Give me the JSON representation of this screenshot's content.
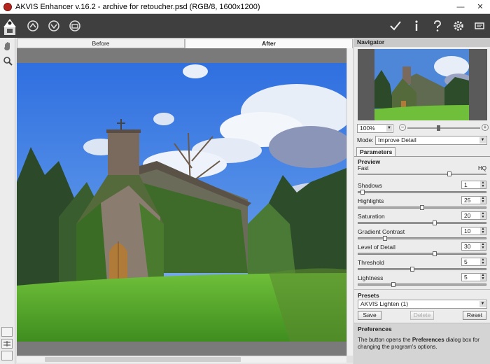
{
  "window": {
    "title": "AKVIS Enhancer v.16.2 - archive for retoucher.psd (RGB/8, 1600x1200)",
    "minimize": "—",
    "close": "✕"
  },
  "toolbar": {
    "icons": [
      "akvis-logo-icon",
      "open-image-icon",
      "save-image-icon",
      "print-icon",
      "run-icon",
      "info-icon",
      "help-icon",
      "settings-icon",
      "messages-icon"
    ]
  },
  "tabs": {
    "before": "Before",
    "after": "After"
  },
  "navigator": {
    "title": "Navigator",
    "zoom": "100%",
    "zoom_minus": "−",
    "zoom_plus": "+",
    "zoom_level": 0.42
  },
  "mode": {
    "label": "Mode:",
    "value": "Improve Detail"
  },
  "parameters": {
    "tab": "Parameters",
    "preview": {
      "title": "Preview",
      "fast": "Fast",
      "hq": "HQ",
      "level": 0.72
    },
    "items": [
      {
        "label": "Shadows",
        "value": "1",
        "level": 0.02
      },
      {
        "label": "Highlights",
        "value": "25",
        "level": 0.5
      },
      {
        "label": "Saturation",
        "value": "20",
        "level": 0.6
      },
      {
        "label": "Gradient Contrast",
        "value": "10",
        "level": 0.2
      },
      {
        "label": "Level of Detail",
        "value": "30",
        "level": 0.6
      },
      {
        "label": "Threshold",
        "value": "5",
        "level": 0.42
      },
      {
        "label": "Lightness",
        "value": "5",
        "level": 0.27
      }
    ]
  },
  "presets": {
    "title": "Presets",
    "value": "AKVIS Lighten (1)",
    "save": "Save",
    "delete": "Delete",
    "reset": "Reset"
  },
  "preferences": {
    "title": "Preferences",
    "text_pre": "The button opens the ",
    "text_bold": "Preferences",
    "text_post": " dialog box for changing the program's options."
  },
  "colors": {
    "toolbar": "#3f3f3f",
    "panel": "#ececec",
    "section_header": "#c9c9c9",
    "accent": "#b3261e"
  }
}
